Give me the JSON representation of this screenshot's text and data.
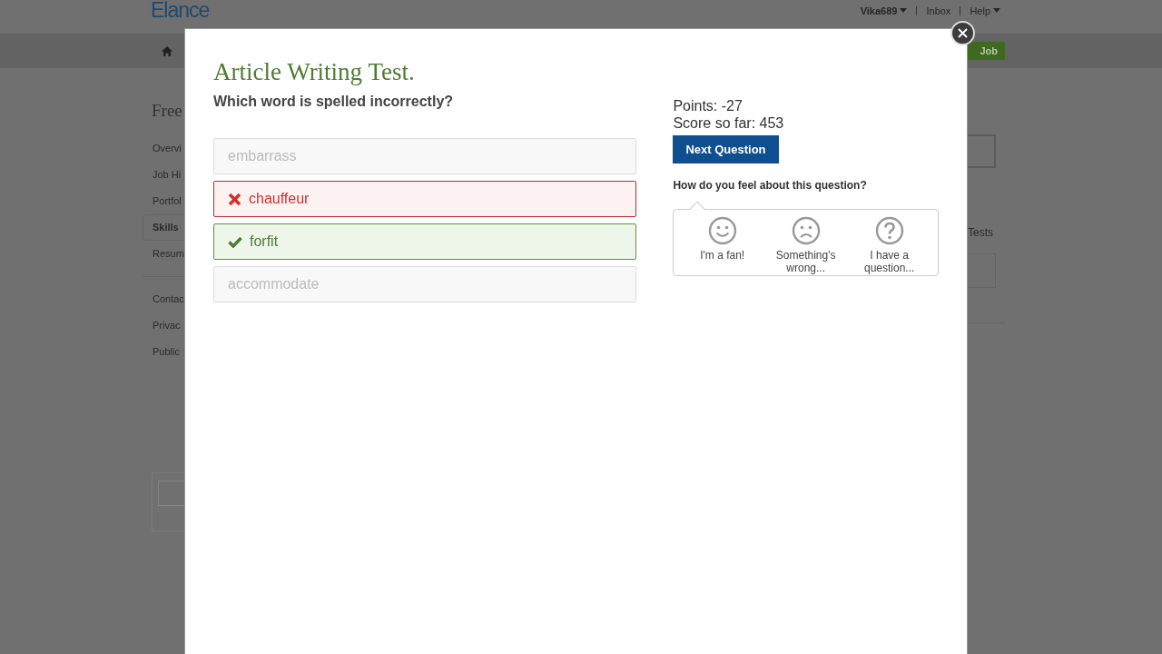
{
  "header": {
    "logo": "Elance",
    "user": "Vika689",
    "links": [
      "Inbox",
      "Help"
    ]
  },
  "nav": {
    "button": "Job"
  },
  "sidebar": {
    "title": "Free",
    "items": [
      {
        "label": "Overvi",
        "selected": false
      },
      {
        "label": "Job Hi",
        "selected": false
      },
      {
        "label": "Portfol",
        "selected": false
      },
      {
        "label": "Skills",
        "selected": true
      },
      {
        "label": "Resum",
        "selected": false
      }
    ],
    "links": [
      "Contac",
      "Privac",
      "Public"
    ]
  },
  "right_column": {
    "tab": "Tests"
  },
  "modal": {
    "title": "Article Writing Test.",
    "question": "Which word is spelled incorrectly?",
    "answers": [
      {
        "label": "embarrass",
        "kind": "neutral"
      },
      {
        "label": "chauffeur",
        "kind": "wrong"
      },
      {
        "label": "forfit",
        "kind": "correct"
      },
      {
        "label": "accommodate",
        "kind": "neutral"
      }
    ],
    "points": "Points: -27",
    "score": "Score so far: 453",
    "next_button": "Next Question",
    "feedback": {
      "prompt": "How do you feel about this question?",
      "options": [
        {
          "label": "I'm a fan!",
          "kind": "happy"
        },
        {
          "label": "Something's wrong...",
          "kind": "sad"
        },
        {
          "label": "I have a question...",
          "kind": "question"
        }
      ]
    }
  }
}
